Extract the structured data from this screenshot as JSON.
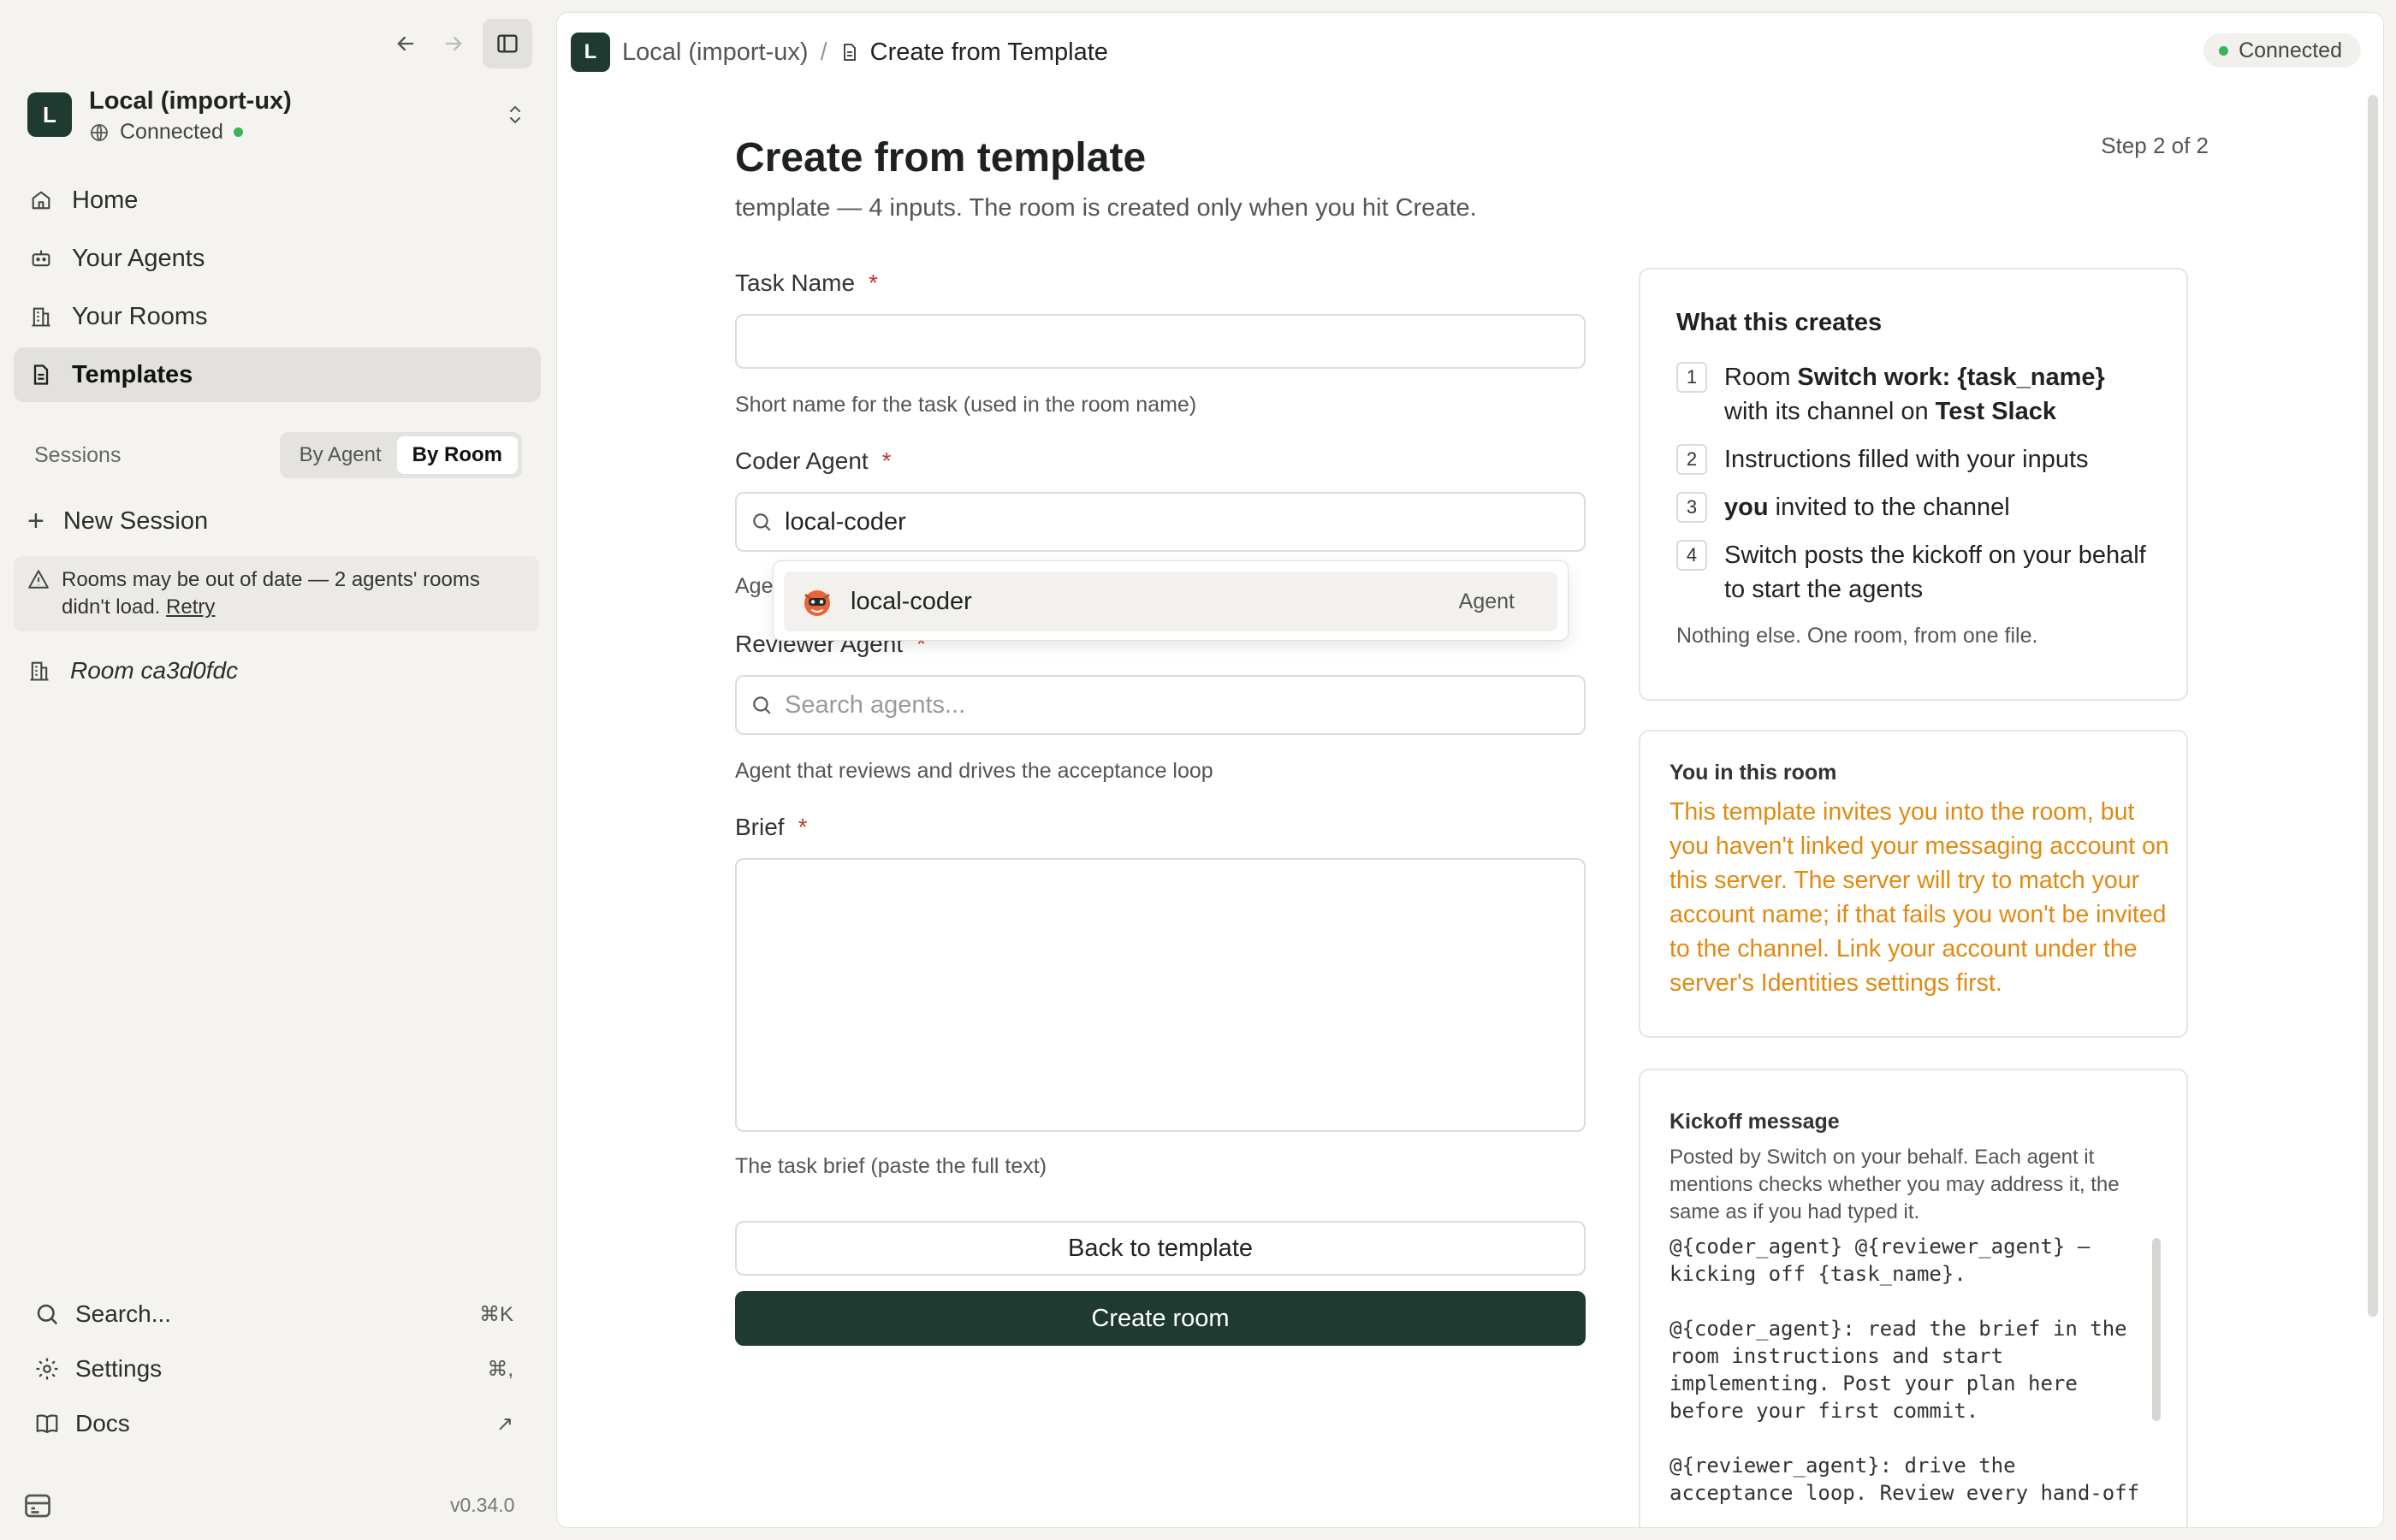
{
  "sidebar": {
    "workspace": {
      "initial": "L",
      "name": "Local (import-ux)",
      "status": "Connected"
    },
    "nav": [
      {
        "label": "Home",
        "icon": "home-icon"
      },
      {
        "label": "Your Agents",
        "icon": "robot-icon"
      },
      {
        "label": "Your Rooms",
        "icon": "building-icon"
      },
      {
        "label": "Templates",
        "icon": "document-icon",
        "active": true
      }
    ],
    "sessions": {
      "label": "Sessions",
      "by_agent": "By Agent",
      "by_room": "By Room"
    },
    "new_session": "New Session",
    "warning": {
      "text": "Rooms may be out of date — 2 agents' rooms didn't load.",
      "retry": "Retry"
    },
    "room": "Room ca3d0fdc",
    "search": {
      "label": "Search...",
      "shortcut": "⌘K"
    },
    "settings": {
      "label": "Settings",
      "shortcut": "⌘,"
    },
    "docs": {
      "label": "Docs",
      "shortcut": "↗"
    },
    "version": "v0.34.0"
  },
  "topbar": {
    "initial": "L",
    "workspace": "Local (import-ux)",
    "separator": "/",
    "page": "Create from Template",
    "status": "Connected"
  },
  "page": {
    "title": "Create from template",
    "subtitle": "template — 4 inputs. The room is created only when you hit Create.",
    "step": "Step 2 of 2"
  },
  "form": {
    "task_name": {
      "label": "Task Name",
      "required": "*",
      "value": "",
      "hint": "Short name for the task (used in the room name)"
    },
    "coder_agent": {
      "label": "Coder Agent",
      "required": "*",
      "value": "local-coder",
      "hint": "Age"
    },
    "dropdown": {
      "name": "local-coder",
      "type": "Agent"
    },
    "reviewer_agent": {
      "label": "Reviewer Agent",
      "required": "*",
      "placeholder": "Search agents...",
      "hint": "Agent that reviews and drives the acceptance loop"
    },
    "brief": {
      "label": "Brief",
      "required": "*",
      "value": "",
      "hint": "The task brief (paste the full text)"
    },
    "back_button": "Back to template",
    "create_button": "Create room"
  },
  "creates_card": {
    "title": "What this creates",
    "items": [
      {
        "num": "1",
        "pre": "Room ",
        "bold": "Switch work: {task_name}",
        "mid": " with its channel on ",
        "bold2": "Test Slack"
      },
      {
        "num": "2",
        "text": "Instructions filled with your inputs"
      },
      {
        "num": "3",
        "bold": "you",
        "text": " invited to the channel"
      },
      {
        "num": "4",
        "text": "Switch posts the kickoff on your behalf to start the agents"
      }
    ],
    "footer": "Nothing else. One room, from one file."
  },
  "you_card": {
    "title": "You in this room",
    "text": "This template invites you into the room, but you haven't linked your messaging account on this server. The server will try to match your account name; if that fails you won't be invited to the channel. Link your account under the server's Identities settings first."
  },
  "kickoff_card": {
    "title": "Kickoff message",
    "description": "Posted by Switch on your behalf. Each agent it mentions checks whether you may address it, the same as if you had typed it.",
    "code": "@{coder_agent} @{reviewer_agent} —\nkicking off {task_name}.\n\n@{coder_agent}: read the brief in the\nroom instructions and start\nimplementing. Post your plan here\nbefore your first commit.\n\n@{reviewer_agent}: drive the\nacceptance loop. Review every hand-off"
  },
  "colors": {
    "brand": "#1f3a30",
    "accent_warning": "#e08a12",
    "status_green": "#3bb35a"
  }
}
